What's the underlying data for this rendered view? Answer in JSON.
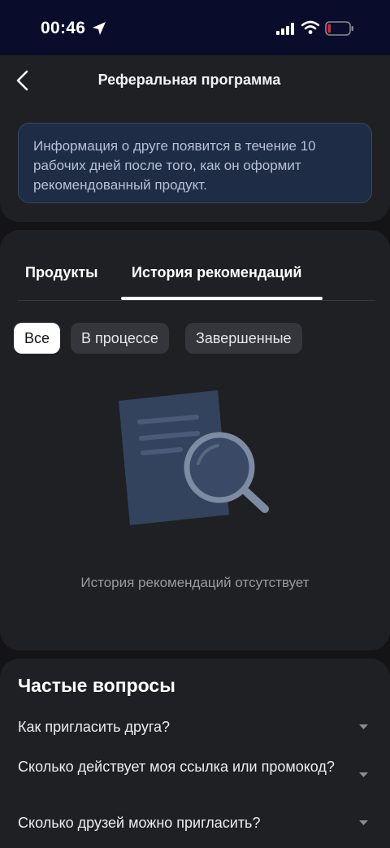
{
  "status_bar": {
    "time": "00:46",
    "icons": [
      "location-arrow-icon",
      "signal-icon",
      "wifi-icon",
      "battery-low-icon"
    ],
    "battery_color": "#e0243b"
  },
  "header": {
    "title": "Реферальная программа",
    "back_icon": "chevron-left-icon"
  },
  "info": {
    "text": "Информация о друге появится в течение 10 рабочих дней после того, как он оформит рекомендованный продукт."
  },
  "tabs": [
    {
      "label": "Продукты",
      "active": false
    },
    {
      "label": "История рекомендаций",
      "active": true
    }
  ],
  "filters": [
    {
      "label": "Все",
      "selected": true
    },
    {
      "label": "В процессе",
      "selected": false
    },
    {
      "label": "Завершенные",
      "selected": false
    }
  ],
  "empty_state": {
    "icon": "document-search-icon",
    "text": "История рекомендаций отсутствует"
  },
  "faq": {
    "title": "Частые вопросы",
    "items": [
      {
        "question": "Как пригласить друга?"
      },
      {
        "question": "Сколько действует моя ссылка или промокод?"
      },
      {
        "question": "Сколько друзей можно пригласить?"
      }
    ]
  },
  "colors": {
    "background": "#141416",
    "card": "#1f2023",
    "info_bg": "#1f2c45",
    "status_bar": "#0a0c2b"
  }
}
